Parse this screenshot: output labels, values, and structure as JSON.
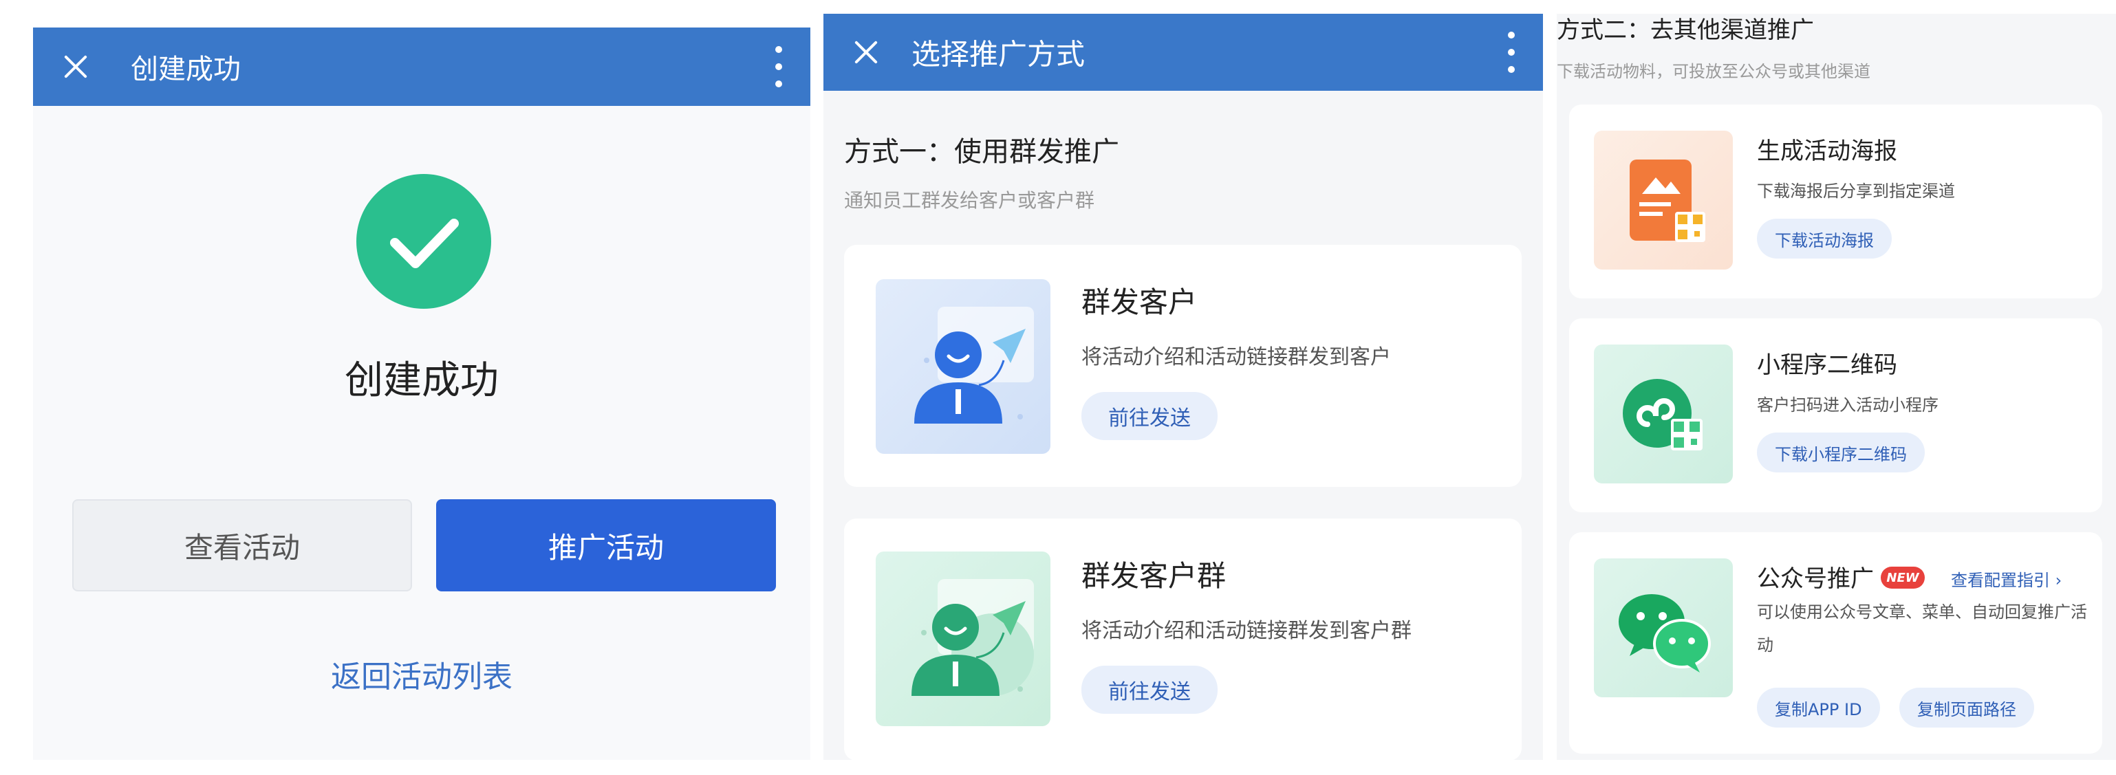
{
  "screen1": {
    "title": "创建成功",
    "success_text": "创建成功",
    "view_button": "查看活动",
    "promote_button": "推广活动",
    "back_link": "返回活动列表"
  },
  "screen2": {
    "title": "选择推广方式",
    "section_title": "方式一：使用群发推广",
    "section_sub": "通知员工群发给客户或客户群",
    "cards": [
      {
        "title": "群发客户",
        "desc": "将活动介绍和活动链接群发到客户",
        "button": "前往发送"
      },
      {
        "title": "群发客户群",
        "desc": "将活动介绍和活动链接群发到客户群",
        "button": "前往发送"
      }
    ]
  },
  "screen3": {
    "section_title": "方式二：去其他渠道推广",
    "section_sub": "下载活动物料，可投放至公众号或其他渠道",
    "cards": [
      {
        "title": "生成活动海报",
        "desc": "下载海报后分享到指定渠道",
        "button": "下载活动海报"
      },
      {
        "title": "小程序二维码",
        "desc": "客户扫码进入活动小程序",
        "button": "下载小程序二维码"
      },
      {
        "title": "公众号推广",
        "badge": "NEW",
        "guide": "查看配置指引 ›",
        "desc": "可以使用公众号文章、菜单、自动回复推广活动",
        "button1": "复制APP ID",
        "button2": "复制页面路径"
      }
    ]
  },
  "colors": {
    "appbar": "#3a78c9",
    "primary": "#2b63d9",
    "success": "#2abf8e",
    "link": "#3b71c6",
    "badge": "#e8413c"
  },
  "icons": [
    "close-icon",
    "more-icon",
    "check-icon",
    "send-customer-icon",
    "send-group-icon",
    "poster-icon",
    "miniprogram-icon",
    "wechat-icon"
  ]
}
